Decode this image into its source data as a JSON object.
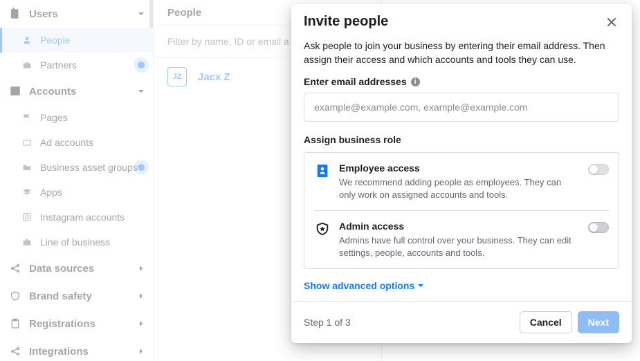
{
  "sidebar": {
    "sections": [
      {
        "label": "Users",
        "items": [
          {
            "label": "People",
            "active": true
          },
          {
            "label": "Partners",
            "pulse": true
          }
        ]
      },
      {
        "label": "Accounts",
        "items": [
          {
            "label": "Pages"
          },
          {
            "label": "Ad accounts"
          },
          {
            "label": "Business asset groups",
            "pulse": true
          },
          {
            "label": "Apps"
          },
          {
            "label": "Instagram accounts"
          },
          {
            "label": "Line of business"
          }
        ]
      },
      {
        "label": "Data sources",
        "hasSub": true
      },
      {
        "label": "Brand safety",
        "hasSub": true
      },
      {
        "label": "Registrations",
        "hasSub": true
      },
      {
        "label": "Integrations",
        "hasSub": true
      }
    ]
  },
  "main": {
    "title": "People",
    "filter_placeholder": "Filter by name, ID or email a",
    "user": {
      "initials": "JZ",
      "name": "Jacx Z"
    }
  },
  "detail": {
    "name": "Jacx Z"
  },
  "modal": {
    "title": "Invite people",
    "description": "Ask people to join your business by entering their email address. Then assign their access and which accounts and tools they can use.",
    "email_label": "Enter email addresses",
    "email_placeholder": "example@example.com, example@example.com",
    "role_label": "Assign business role",
    "roles": [
      {
        "title": "Employee access",
        "desc": "We recommend adding people as employees. They can only work on assigned accounts and tools.",
        "toggle": false,
        "disabled": true
      },
      {
        "title": "Admin access",
        "desc": "Admins have full control over your business. They can edit settings, people, accounts and tools.",
        "toggle": false,
        "disabled": false
      }
    ],
    "advanced_label": "Show advanced options",
    "step_text": "Step 1 of 3",
    "cancel_label": "Cancel",
    "next_label": "Next"
  }
}
